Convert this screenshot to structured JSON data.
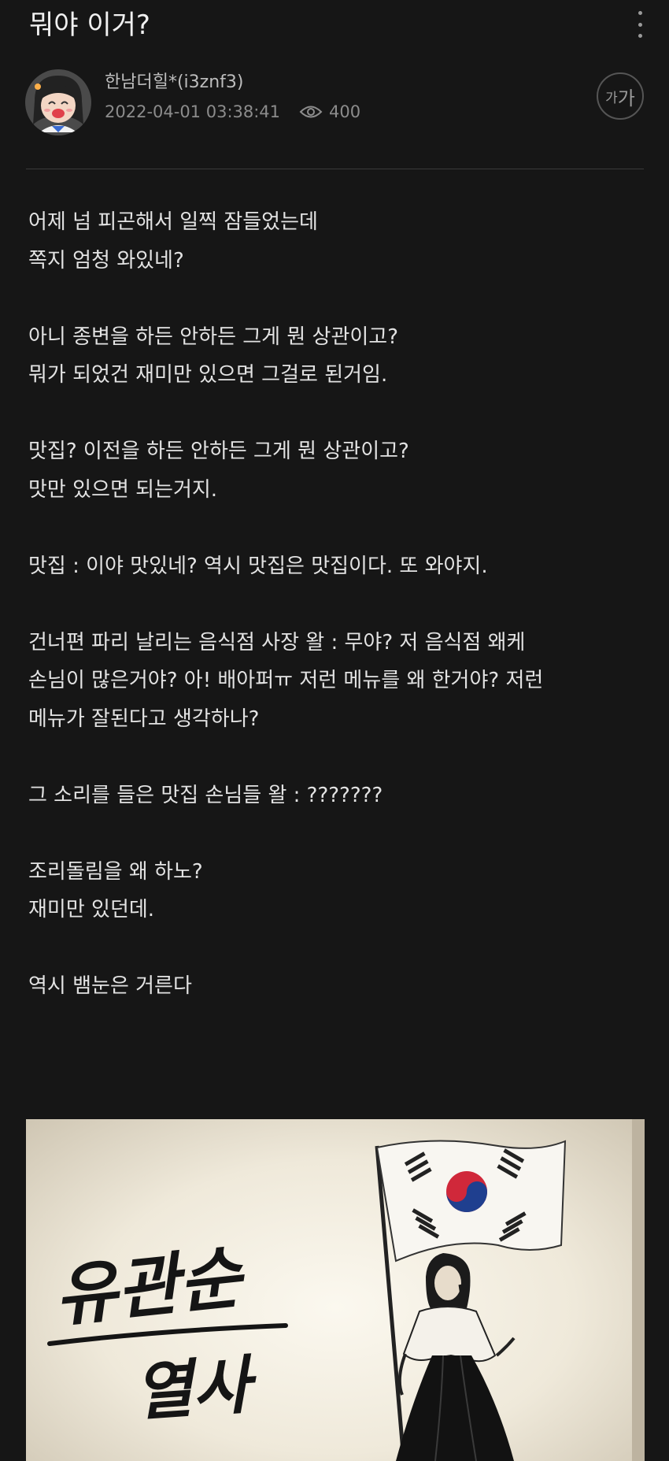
{
  "post": {
    "title": "뭐야 이거?",
    "author": "한남더힐*(i3znf3)",
    "datetime": "2022-04-01 03:38:41",
    "views": "400",
    "font_size_button": {
      "small": "가",
      "big": "가"
    },
    "paragraphs": [
      "어제 넘 피곤해서 일찍 잠들었는데\n쪽지 엄청 와있네?",
      "아니 종변을 하든 안하든 그게 뭔 상관이고?\n뭐가 되었건 재미만 있으면 그걸로 된거임.",
      "맛집? 이전을 하든 안하든 그게 뭔 상관이고?\n맛만 있으면 되는거지.",
      "맛집 : 이야 맛있네? 역시 맛집은 맛집이다. 또 와야지.",
      "건너편 파리 날리는 음식점 사장 왈 : 무야? 저 음식점 왜케\n손님이 많은거야? 아! 배아퍼ㅠ 저런 메뉴를 왜 한거야? 저런\n메뉴가 잘된다고 생각하나?",
      "그 소리를 들은 맛집 손님들 왈 : ???????",
      "조리돌림을 왜 하노?\n재미만 있던데.",
      "역시 뱀눈은 거른다"
    ],
    "image": {
      "calligraphy_line1": "유관순",
      "calligraphy_line2": "열사"
    }
  },
  "icons": {
    "more": "more-vertical-icon",
    "eye": "eye-icon",
    "font": "font-size-icon"
  },
  "colors": {
    "background": "#161616",
    "text": "#e3e3e3",
    "muted": "#8c8c8c",
    "flag_red": "#d0283a",
    "flag_blue": "#1f3f8f"
  }
}
